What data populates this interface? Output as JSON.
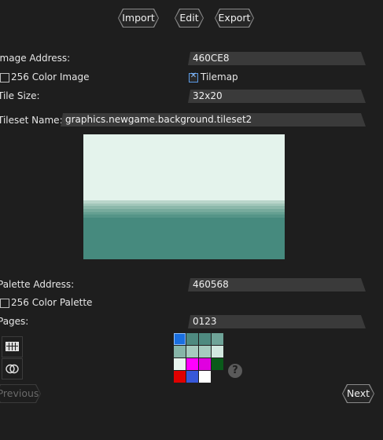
{
  "toolbar": {
    "import_label": "Import",
    "edit_label": "Edit",
    "export_label": "Export"
  },
  "form": {
    "image_address": {
      "label": "Image Address:",
      "value": "460CE8"
    },
    "color256_image": {
      "label": "256 Color Image",
      "checked": false
    },
    "tilemap": {
      "label": "Tilemap",
      "checked": true
    },
    "tile_size": {
      "label": "Tile Size:",
      "value": "32x20"
    },
    "tileset_name": {
      "label": "Tileset Name:",
      "value": "graphics.newgame.background.tileset2"
    },
    "palette_address": {
      "label": "Palette Address:",
      "value": "460568"
    },
    "color256_palette": {
      "label": "256 Color Palette",
      "checked": false
    },
    "pages": {
      "label": "Pages:",
      "value": "0123"
    }
  },
  "preview": {
    "sky_color": "#e4f3ec",
    "sea_color": "#468a7e",
    "band_colors": [
      "#b9d5ca",
      "#a2c7ba",
      "#8cb8aa",
      "#77ab9d",
      "#64a092",
      "#559588"
    ]
  },
  "palette": {
    "colors": [
      "#1a6fe0",
      "#4e8a80",
      "#4e8a80",
      "#6fa498",
      "#86b5a8",
      "#a6cbbf",
      "#a6cbbf",
      "#d2e8df",
      "#e8f5ef",
      "#ff00ff",
      "#e000e0",
      "#0a5a1a",
      "#e00000",
      "#3858d8",
      "#ffffff",
      "#1e1e1e"
    ],
    "selected_index": 0
  },
  "tools": {
    "tile_grid_icon": "tile-grid-icon",
    "overlap_icon": "overlap-circles-icon"
  },
  "help": {
    "glyph": "?"
  },
  "nav": {
    "previous_label": "Previous",
    "next_label": "Next"
  },
  "colors": {
    "background": "#1e1e1e",
    "field_bg": "#3a3a3a",
    "accent": "#1a6fe0"
  }
}
